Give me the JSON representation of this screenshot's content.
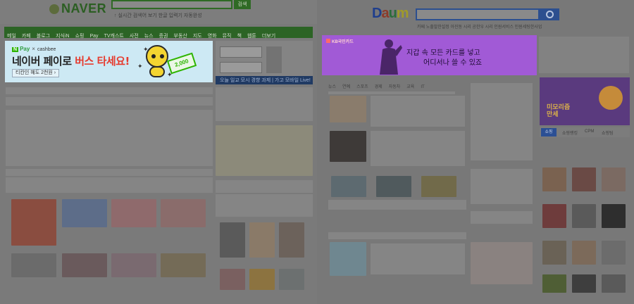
{
  "naver": {
    "logo_text": "NAVER",
    "search_button": "검색",
    "search_hints": "↑ 실시간 검색어 보기    한글 입력기    자동완성",
    "menu": [
      "메일",
      "카페",
      "블로그",
      "지식iN",
      "쇼핑",
      "Pay",
      "TV캐스트",
      "사전",
      "뉴스",
      "증권",
      "부동산",
      "지도",
      "영화",
      "뮤직",
      "책",
      "웹툰",
      "더보기"
    ],
    "ad": {
      "pay_badge": "N",
      "pay_text": "Pay",
      "x": "×",
      "partner": "cashbee",
      "headline_prefix": "네이버 페이로 ",
      "headline_highlight": "버스 타세요!",
      "sub": "티칸인 혜도 2천원 ›",
      "ticket_value": "2,000"
    },
    "news_banner": "오늘 일교 모시 경향 과제 | 가고 모바일 Live!"
  },
  "daum": {
    "logo": [
      "D",
      "a",
      "u",
      "m"
    ],
    "links": "카페 노출발한설정    아진동    시리    공한우    시리    인원서비스    인원세팅한사업",
    "ad": {
      "brand": "KB국민카드",
      "line1": "지갑 속 모든 카드를 넣고",
      "line2": "어디서나 쓸 수 있죠"
    },
    "tabs": [
      "뉴스",
      "연예",
      "스포츠",
      "경제",
      "자동차",
      "교육",
      "IT"
    ],
    "promo_label_1": "미모리즘",
    "promo_label_2": "만세",
    "shop_tabs": [
      "쇼핑",
      "쇼핑랭킹",
      "CPM",
      "쇼핑팀",
      "쇼핑"
    ]
  },
  "colors": {
    "naver_green": "#2c6425",
    "naver_pay_green": "#2db400",
    "ad_naver_bg": "#cde9f4",
    "ad_highlight": "#e63b2e",
    "daum_blue": "#2c4f8f",
    "ad_daum_bg": "#a15ad6",
    "dim_overlay": "#7a7a7a"
  }
}
